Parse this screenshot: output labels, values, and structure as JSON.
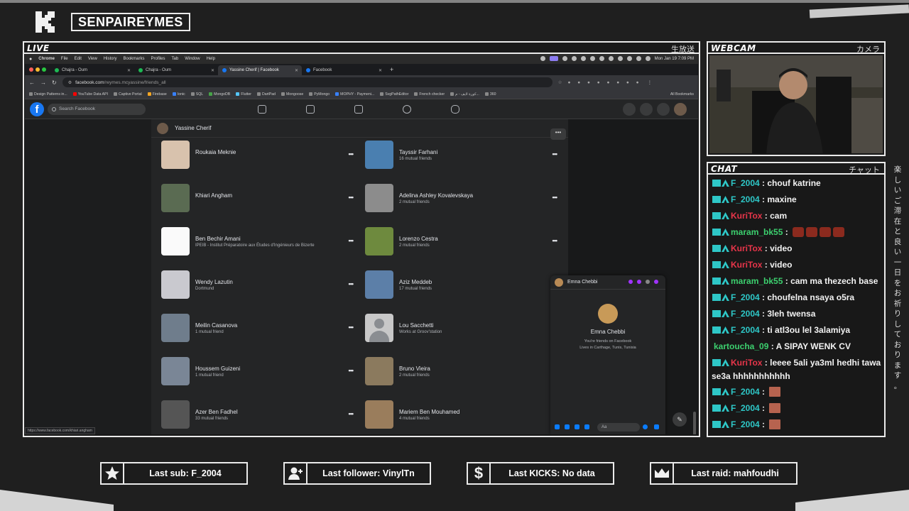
{
  "overlay": {
    "channel_name": "SENPAIREYMES",
    "live_label": "LIVE",
    "live_jp": "生放送",
    "webcam_label": "WEBCAM",
    "webcam_jp": "カメラ",
    "chat_label": "CHAT",
    "chat_jp": "チャット",
    "vertical_jp": "楽しいご滞在と良い一日をお祈りしております。",
    "stats": [
      {
        "label": "Last sub: F_2004",
        "icon": "star-icon"
      },
      {
        "label": "Last follower: VinylTn",
        "icon": "add-user-icon"
      },
      {
        "label": "Last KICKS: No data",
        "icon": "dollar-icon"
      },
      {
        "label": "Last raid: mahfoudhi",
        "icon": "crown-icon"
      }
    ],
    "chat_messages": [
      {
        "user": "F_2004",
        "text": "chouf katrine",
        "color": "#2ec7c7",
        "emotes": 0
      },
      {
        "user": "F_2004",
        "text": "maxine",
        "color": "#2ec7c7",
        "emotes": 0
      },
      {
        "user": "KuriTox",
        "text": "cam",
        "color": "#e8354a",
        "emotes": 0
      },
      {
        "user": "maram_bk55",
        "text": "",
        "color": "#3ccf6e",
        "emotes": 4
      },
      {
        "user": "KuriTox",
        "text": "video",
        "color": "#e8354a",
        "emotes": 0
      },
      {
        "user": "KuriTox",
        "text": "video",
        "color": "#e8354a",
        "emotes": 0
      },
      {
        "user": "maram_bk55",
        "text": "cam ma thezech base",
        "color": "#3ccf6e",
        "emotes": 0
      },
      {
        "user": "F_2004",
        "text": "choufelna nsaya o5ra",
        "color": "#2ec7c7",
        "emotes": 0
      },
      {
        "user": "F_2004",
        "text": "3leh twensa",
        "color": "#2ec7c7",
        "emotes": 0
      },
      {
        "user": "F_2004",
        "text": "ti atl3ou lel 3alamiya",
        "color": "#2ec7c7",
        "emotes": 0
      },
      {
        "user": "kartoucha_09",
        "text": "A SIPAY WENK CV",
        "color": "#3ccf6e",
        "emotes": 0,
        "nobadge": true
      },
      {
        "user": "KuriTox",
        "text": "leeee 5ali ya3ml hedhi tawa",
        "text2": "se3a hhhhhhhhhhh",
        "color": "#e8354a",
        "emotes": 0
      },
      {
        "user": "F_2004",
        "text": "",
        "color": "#2ec7c7",
        "emotes": 1
      },
      {
        "user": "F_2004",
        "text": "",
        "color": "#2ec7c7",
        "emotes": 1
      },
      {
        "user": "F_2004",
        "text": "",
        "color": "#2ec7c7",
        "emotes": 1
      }
    ]
  },
  "macbar": {
    "items": [
      "Chrome",
      "File",
      "Edit",
      "View",
      "History",
      "Bookmarks",
      "Profiles",
      "Tab",
      "Window",
      "Help"
    ],
    "clock": "Mon Jan 19  7:09 PM"
  },
  "tabs": [
    {
      "title": "Chajra - Oum",
      "active": false,
      "color": "#1db954"
    },
    {
      "title": "Chajra - Oum",
      "active": false,
      "color": "#1db954"
    },
    {
      "title": "Yassine Cherif | Facebook",
      "active": true,
      "color": "#1877f2"
    },
    {
      "title": "Facebook",
      "active": false,
      "color": "#1877f2"
    }
  ],
  "url": {
    "host": "facebook.com",
    "path": "/reymes.mcyassine/friends_all"
  },
  "bookmarks": [
    "Design Patterns in...",
    "YouTube Data API",
    "Captive Portal",
    "Firebase",
    "Ionic",
    "SQL",
    "MongoDB",
    "Flutter",
    "DartPad",
    "Mongoose",
    "PyMongo",
    "MOPHY - Paymeni...",
    "SvgPathEditor",
    "French checker",
    "كورة لايف - م...",
    "360"
  ],
  "all_bookmarks": "All Bookmarks",
  "facebook": {
    "search_placeholder": "Search Facebook",
    "profile_name": "Yassine Cherif",
    "status_url": "https://www.facebook.com/khiari.angham",
    "friends_left": [
      {
        "name": "Roukaia Meknie",
        "sub": ""
      },
      {
        "name": "Khiari Angham",
        "sub": ""
      },
      {
        "name": "Ben Bechir Amani",
        "sub": "IPEIB - Institut Préparatoire aux Études d'Ingénieurs de Bizerte"
      },
      {
        "name": "Wendy Lazutin",
        "sub": "Dortmund"
      },
      {
        "name": "Meilin Casanova",
        "sub": "1 mutual friend"
      },
      {
        "name": "Houssem Guizeni",
        "sub": "1 mutual friend"
      },
      {
        "name": "Azer Ben Fadhel",
        "sub": "33 mutual friends"
      }
    ],
    "friends_right": [
      {
        "name": "Tayssir Farhani",
        "sub": "16 mutual friends"
      },
      {
        "name": "Adelina Ashley Kovalevskaya",
        "sub": "2 mutual friends"
      },
      {
        "name": "Lorenzo Cestra",
        "sub": "2 mutual friends"
      },
      {
        "name": "Aziz Meddeb",
        "sub": "17 mutual friends"
      },
      {
        "name": "Lou Sacchetti",
        "sub": "Works at Groov'station"
      },
      {
        "name": "Bruno Vieira",
        "sub": "2 mutual friends"
      },
      {
        "name": "Mariem Ben Mouhamed",
        "sub": "4 mutual friends"
      }
    ],
    "chat_popup": {
      "name": "Emna Chebbi",
      "line1": "You're friends on Facebook",
      "line2": "Lives in Carthage, Tunis, Tunisia",
      "input_placeholder": "Aa"
    }
  }
}
